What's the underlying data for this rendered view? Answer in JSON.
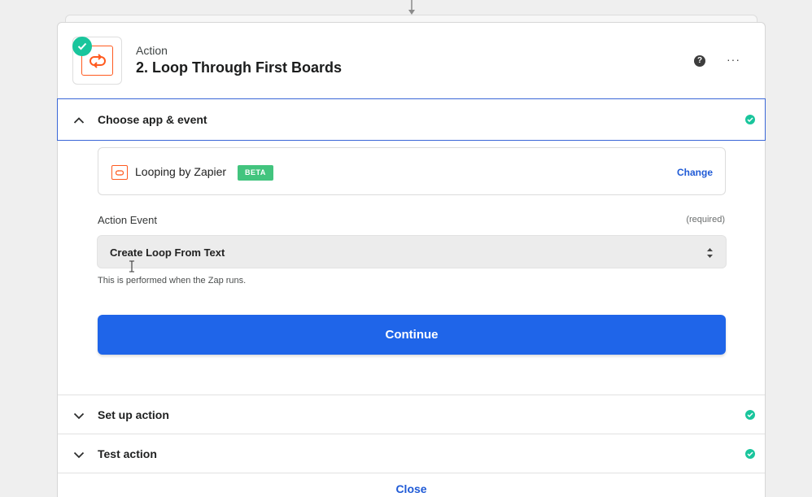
{
  "step": {
    "kind": "Action",
    "title": "2. Loop Through First Boards",
    "help_icon": "question-icon",
    "more_icon": "more-dots-icon",
    "help_glyph": "?",
    "more_glyph": "···"
  },
  "sections": {
    "choose": {
      "label": "Choose app & event",
      "status": "complete"
    },
    "setup": {
      "label": "Set up action",
      "status": "complete"
    },
    "test": {
      "label": "Test action",
      "status": "complete"
    }
  },
  "app": {
    "name": "Looping by Zapier",
    "badge": "BETA",
    "change_label": "Change"
  },
  "event": {
    "label": "Action Event",
    "required": "(required)",
    "value": "Create Loop From Text",
    "hint": "This is performed when the Zap runs."
  },
  "buttons": {
    "continue": "Continue",
    "close": "Close"
  },
  "colors": {
    "success": "#19c59c",
    "primary": "#1f65e9",
    "link": "#1f5ad6",
    "app_brand": "#ff5a1f",
    "beta": "#42c47e",
    "focus_border": "#3a67d7"
  }
}
